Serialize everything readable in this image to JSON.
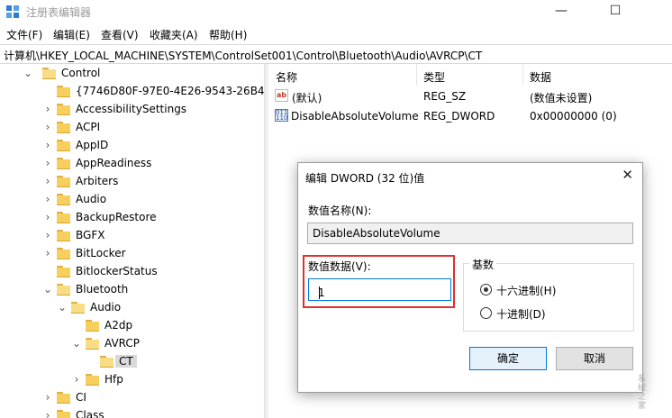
{
  "window": {
    "title": "注册表编辑器",
    "controls": {
      "minimize": "—",
      "maximize": "☐"
    }
  },
  "menu": [
    "文件(F)",
    "编辑(E)",
    "查看(V)",
    "收藏夹(A)",
    "帮助(H)"
  ],
  "address": "计算机\\HKEY_LOCAL_MACHINE\\SYSTEM\\ControlSet001\\Control\\Bluetooth\\Audio\\AVRCP\\CT",
  "tree": [
    {
      "label": "Control",
      "expanded": true
    },
    {
      "label": "{7746D80F-97E0-4E26-9543-26B4"
    },
    {
      "label": "AccessibilitySettings"
    },
    {
      "label": "ACPI"
    },
    {
      "label": "AppID"
    },
    {
      "label": "AppReadiness"
    },
    {
      "label": "Arbiters"
    },
    {
      "label": "Audio"
    },
    {
      "label": "BackupRestore"
    },
    {
      "label": "BGFX"
    },
    {
      "label": "BitLocker"
    },
    {
      "label": "BitlockerStatus"
    },
    {
      "label": "Bluetooth",
      "expanded": true
    },
    {
      "label": "Audio",
      "expanded": true
    },
    {
      "label": "A2dp"
    },
    {
      "label": "AVRCP",
      "expanded": true
    },
    {
      "label": "CT",
      "selected": true
    },
    {
      "label": "Hfp"
    },
    {
      "label": "CI"
    },
    {
      "label": "Class"
    }
  ],
  "list": {
    "columns": [
      "名称",
      "类型",
      "数据"
    ],
    "rows": [
      {
        "name": "(默认)",
        "type": "REG_SZ",
        "data": "(数值未设置)",
        "icon": "string-value-icon"
      },
      {
        "name": "DisableAbsoluteVolume",
        "type": "REG_DWORD",
        "data": "0x00000000 (0)",
        "icon": "dword-value-icon"
      }
    ]
  },
  "dialog": {
    "title": "编辑 DWORD (32 位)值",
    "close": "✕",
    "name_label": "数值名称(N):",
    "name_value": "DisableAbsoluteVolume",
    "data_label": "数值数据(V):",
    "data_value": "1",
    "base_label": "基数",
    "hex_label": "十六进制(H)",
    "dec_label": "十进制(D)",
    "selected_base": "hex",
    "ok": "确定",
    "cancel": "取消",
    "highlight_color": "#e03030"
  },
  "watermark": "系统之家"
}
